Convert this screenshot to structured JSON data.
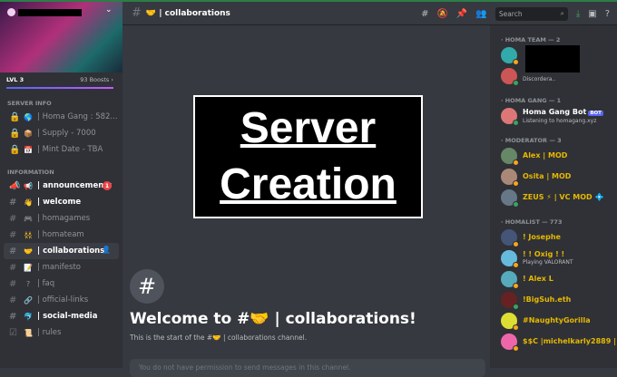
{
  "server": {
    "level": "LVL 3",
    "boosts": "93 Boosts ›"
  },
  "sidebar": {
    "categories": [
      {
        "label": "SERVER INFO"
      },
      {
        "label": "INFORMATION"
      }
    ],
    "info_channels": [
      {
        "icon": "🌎",
        "label": "| Homa Gang : 582..."
      },
      {
        "icon": "📦",
        "label": "| Supply - 7000"
      },
      {
        "icon": "📅",
        "label": "| Mint Date - TBA"
      }
    ],
    "channels": [
      {
        "icon": "📢",
        "label": "| announcements",
        "badge": "1"
      },
      {
        "icon": "👋",
        "label": "| welcome"
      },
      {
        "icon": "🎮",
        "label": "| homagames"
      },
      {
        "icon": "👯",
        "label": "| homateam"
      },
      {
        "icon": "🤝",
        "label": "| collaborations"
      },
      {
        "icon": "📝",
        "label": "| manifesto"
      },
      {
        "icon": "?",
        "label": "| faq"
      },
      {
        "icon": "🔗",
        "label": "| official-links"
      },
      {
        "icon": "🐬",
        "label": "| social-media"
      },
      {
        "icon": "📜",
        "label": "| rules"
      }
    ]
  },
  "header": {
    "channel": "🤝 | collaborations",
    "search_placeholder": "Search"
  },
  "main": {
    "image_text_1": "Server",
    "image_text_2": "Creation",
    "welcome": "Welcome to #🤝 | collaborations!",
    "start": "This is the start of the #🤝 | collaborations channel.",
    "permission": "You do not have permission to send messages in this channel."
  },
  "members": {
    "groups": [
      {
        "label": "· HOMA TEAM — 2"
      },
      {
        "label": "· HOMA GANG — 1"
      },
      {
        "label": "· MODERATOR — 3"
      },
      {
        "label": "· HOMALIST — 773"
      }
    ],
    "team_status": "Discordera..",
    "bot": {
      "name": "Homa Gang Bot",
      "tag": "BOT",
      "status": "Listening to homagang.xyz"
    },
    "mods": [
      "Alex | MOD",
      "Osita | MOD",
      "ZEUS ⚡ | VC MOD 💠"
    ],
    "homalist": [
      {
        "name": "! Josephe"
      },
      {
        "name": "! ! Oxig ! !",
        "status": "Playing VALORANT"
      },
      {
        "name": "! Alex L"
      },
      {
        "name": "!BigSuh.eth"
      },
      {
        "name": "#NaughtyGorilla"
      },
      {
        "name": "$$C |michelkarly2889 |"
      }
    ]
  }
}
